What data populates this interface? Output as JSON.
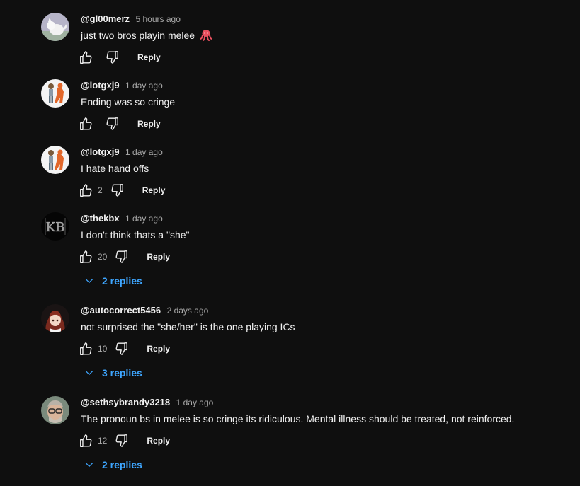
{
  "comments": [
    {
      "author": "@gl00merz",
      "time": "5 hours ago",
      "text": "just two bros playin melee",
      "emoji": "octopus-emoji",
      "likes": "",
      "reply_label": "Reply",
      "avatar": "white-fox-avatar"
    },
    {
      "author": "@lotgxj9",
      "time": "1 day ago",
      "text": "Ending was so cringe",
      "likes": "",
      "reply_label": "Reply",
      "avatar": "orange-character-avatar"
    },
    {
      "author": "@lotgxj9",
      "time": "1 day ago",
      "text": "I hate hand offs",
      "likes": "2",
      "reply_label": "Reply",
      "avatar": "orange-character-avatar"
    },
    {
      "author": "@thekbx",
      "time": "1 day ago",
      "text": "I don't think thats a \"she\"",
      "likes": "20",
      "reply_label": "Reply",
      "replies_label": "2 replies",
      "avatar": "kb-logo-avatar"
    },
    {
      "author": "@autocorrect5456",
      "time": "2 days ago",
      "text": "not surprised the \"she/her\" is the one playing ICs",
      "likes": "10",
      "reply_label": "Reply",
      "replies_label": "3 replies",
      "avatar": "anime-girl-avatar"
    },
    {
      "author": "@sethsybrandy3218",
      "time": "1 day ago",
      "text": "The pronoun bs in melee is so cringe its ridiculous. Mental illness should be treated, not reinforced.",
      "likes": "12",
      "reply_label": "Reply",
      "replies_label": "2 replies",
      "avatar": "man-glasses-avatar"
    }
  ],
  "colors": {
    "background": "#0f0f0f",
    "text_primary": "#f1f1f1",
    "text_secondary": "#aaaaaa",
    "link_blue": "#3ea6ff"
  },
  "icons": {
    "like": "thumbs-up-icon",
    "dislike": "thumbs-down-icon",
    "expand": "chevron-down-icon"
  }
}
